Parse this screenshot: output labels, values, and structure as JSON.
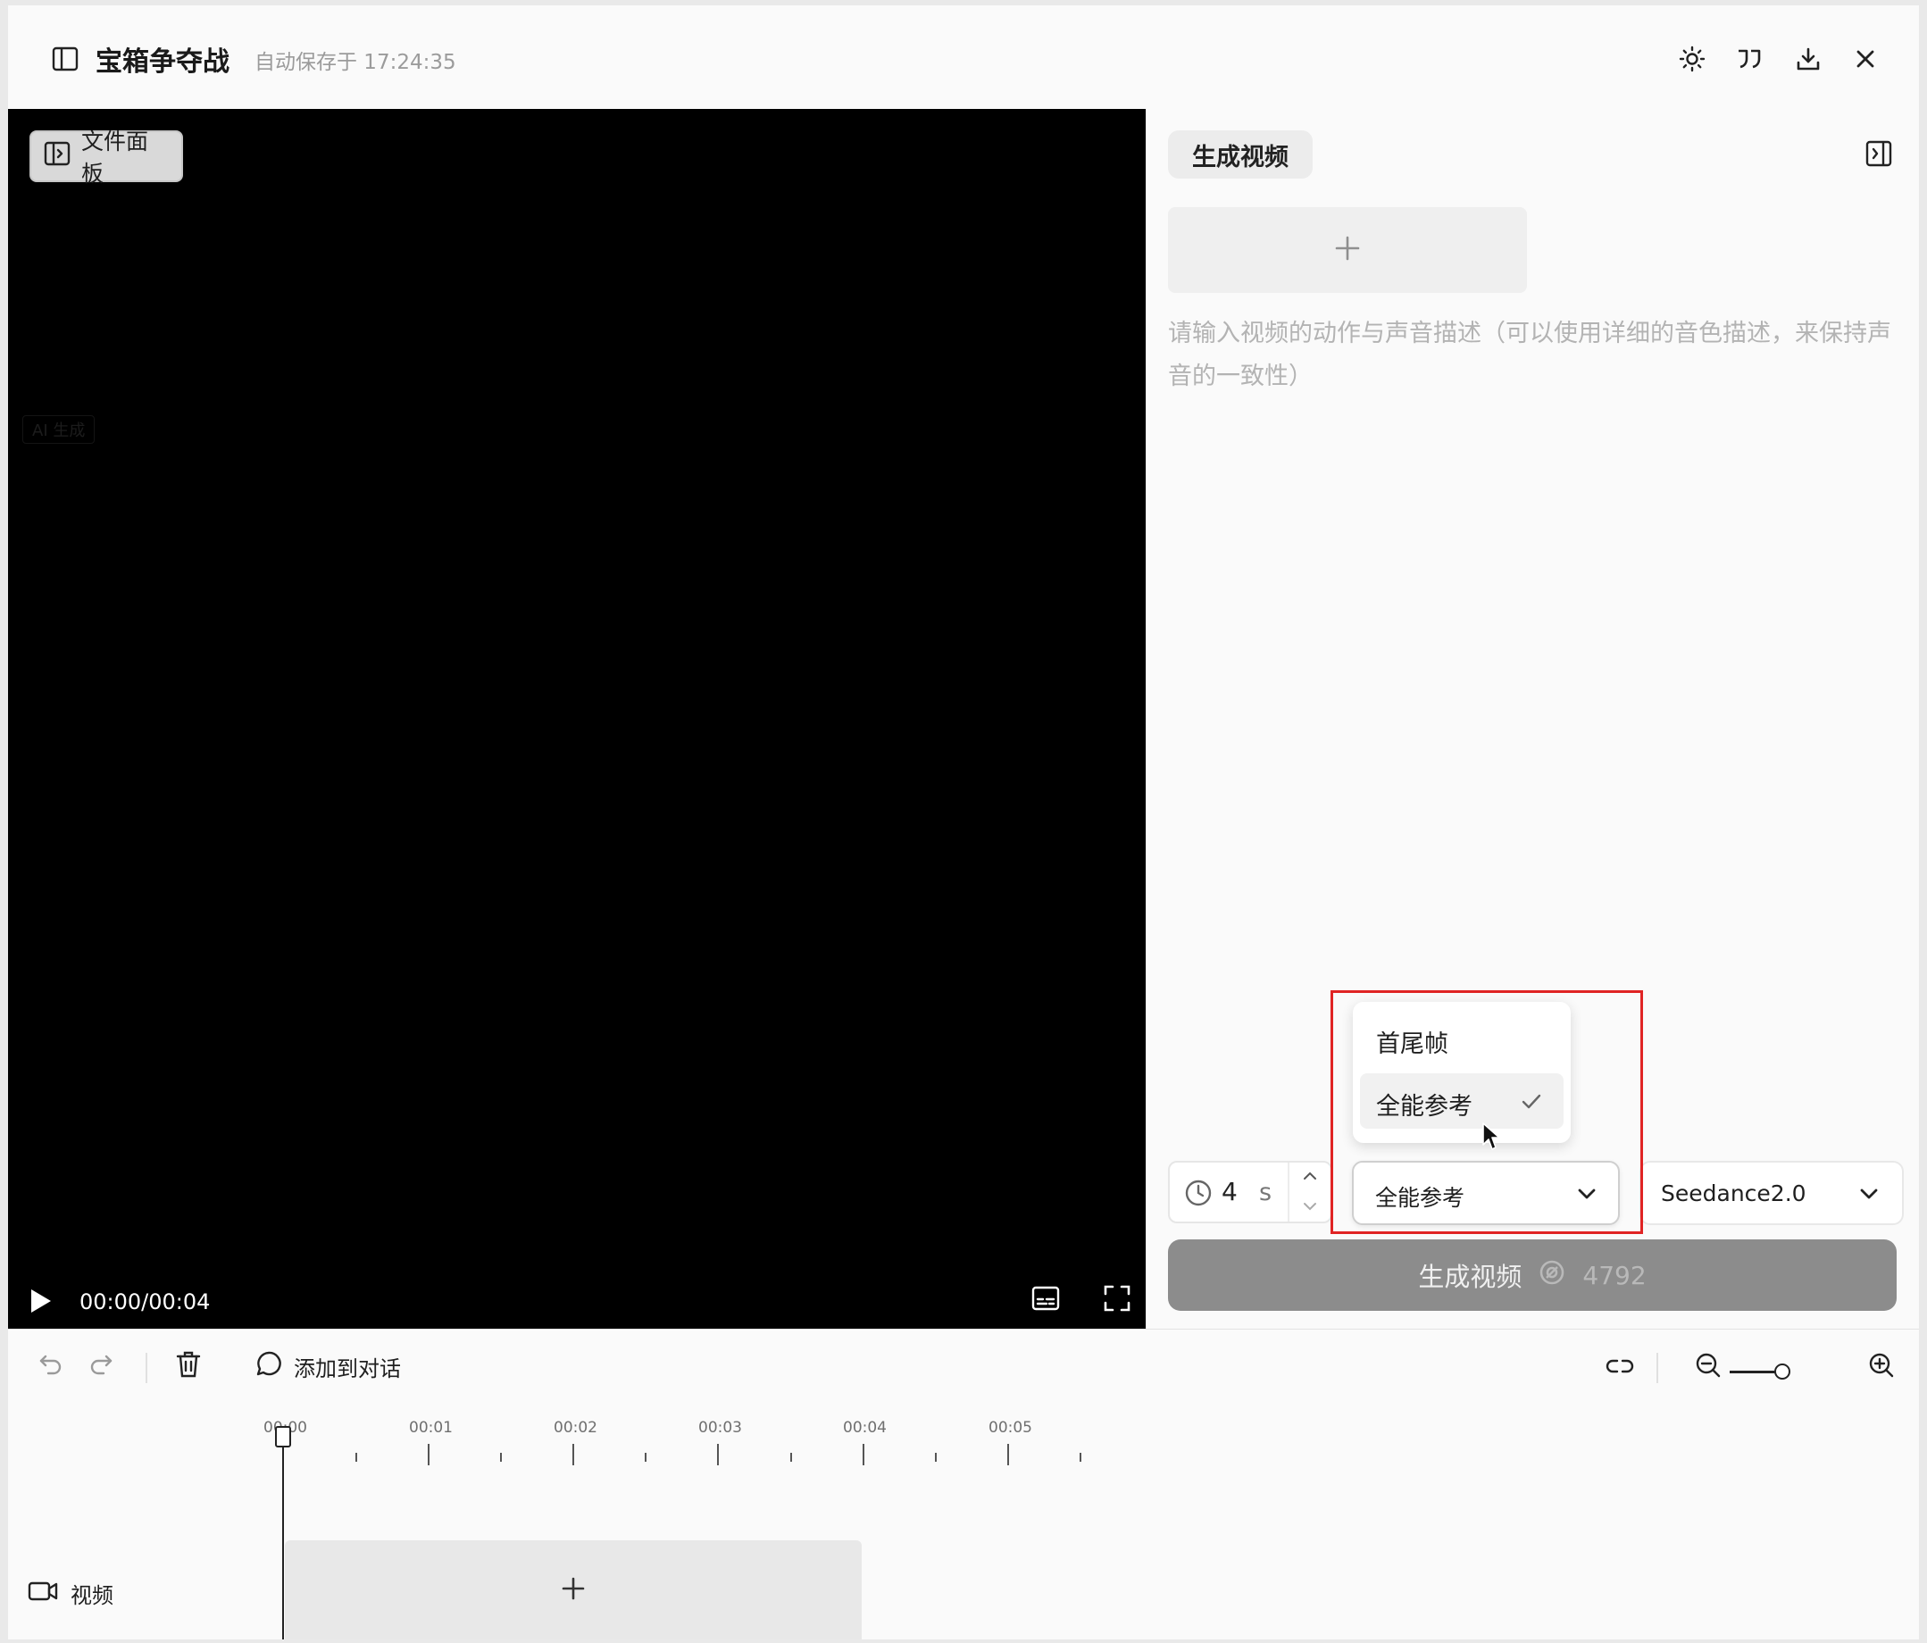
{
  "header": {
    "title": "宝箱争夺战",
    "autosave": "自动保存于 17:24:35"
  },
  "video": {
    "file_panel_label": "文件面板",
    "ai_badge": "AI 生成",
    "timecode": "00:00/00:04"
  },
  "panel": {
    "tab_label": "生成视频",
    "prompt_placeholder": "请输入视频的动作与声音描述（可以使用详细的音色描述，来保持声音的一致性）",
    "duration_value": "4",
    "duration_unit": "s",
    "mode_selected": "全能参考",
    "mode_options": [
      "首尾帧",
      "全能参考"
    ],
    "model_selected": "Seedance2.0",
    "generate_label": "生成视频",
    "credits": "4792"
  },
  "timeline": {
    "add_to_dialog": "添加到对话",
    "ticks": [
      "00:00",
      "00:01",
      "00:02",
      "00:03",
      "00:04",
      "00:05"
    ],
    "track_label": "视频"
  },
  "colors": {
    "highlight": "#e02424",
    "generate_button": "#8c8c8c"
  }
}
